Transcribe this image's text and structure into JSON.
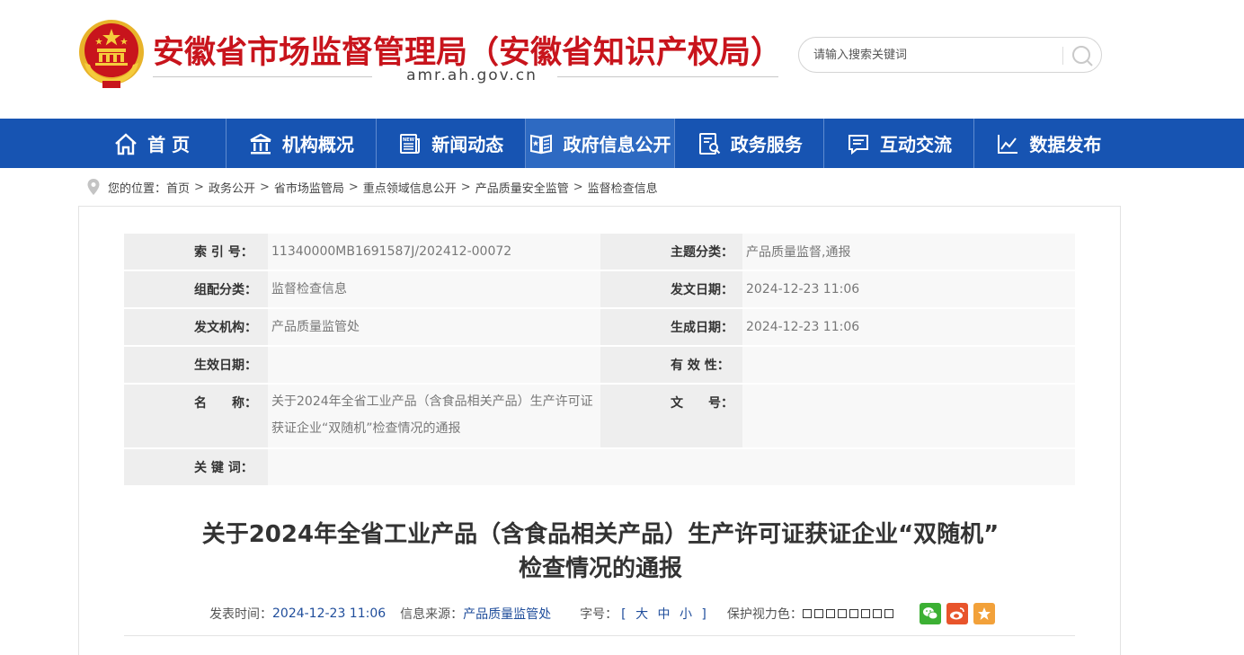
{
  "header": {
    "title": "安徽省市场监督管理局（安徽省知识产权局）",
    "domain": "amr.ah.gov.cn",
    "search_placeholder": "请输入搜索关键词",
    "brand_color": "#c8141c"
  },
  "nav": {
    "items": [
      {
        "label": "首 页",
        "icon": "home-icon"
      },
      {
        "label": "机构概况",
        "icon": "institution-icon"
      },
      {
        "label": "新闻动态",
        "icon": "news-icon"
      },
      {
        "label": "政府信息公开",
        "icon": "gov-info-icon",
        "active": true
      },
      {
        "label": "政务服务",
        "icon": "service-icon"
      },
      {
        "label": "互动交流",
        "icon": "chat-icon"
      },
      {
        "label": "数据发布",
        "icon": "chart-icon"
      }
    ],
    "bg_color": "#1754b2"
  },
  "breadcrumb": {
    "prefix": "您的位置：",
    "items": [
      "首页",
      "政务公开",
      "省市场监管局",
      "重点领域信息公开",
      "产品质量安全监管",
      "监督检查信息"
    ]
  },
  "info": {
    "index_label": "索 引 号：",
    "index_value": "11340000MB1691587J/202412-00072",
    "topic_label": "主题分类：",
    "topic_value": "产品质量监督,通报",
    "org_label": "组配分类：",
    "org_value": "监督检查信息",
    "date_label": "发文日期：",
    "date_value": "2024-12-23 11:06",
    "issuer_label": "发文机构：",
    "issuer_value": "产品质量监管处",
    "gen_label": "生成日期：",
    "gen_value": "2024-12-23 11:06",
    "effective_label": "生效日期：",
    "effective_value": "",
    "validity_label": "有 效 性：",
    "validity_value": "",
    "name_label": "名　　称：",
    "name_value": "关于2024年全省工业产品（含食品相关产品）生产许可证获证企业“双随机”检查情况的通报",
    "docno_label": "文　　号：",
    "docno_value": "",
    "keywords_label": "关 键 词：",
    "keywords_value": ""
  },
  "article": {
    "title_line1": "关于2024年全省工业产品（含食品相关产品）生产许可证获证企业“双随机”",
    "title_line2": "检查情况的通报",
    "pub_time_label": "发表时间：",
    "pub_time": "2024-12-23 11:06",
    "source_label": "信息来源：",
    "source": "产品质量监管处",
    "font_label": "字号：",
    "font_sizes": "[ 大 中 小 ]",
    "color_label": "保护视力色："
  },
  "share": [
    {
      "icon": "wechat-icon",
      "color": "#3cb034"
    },
    {
      "icon": "weibo-icon",
      "color": "#e8542b"
    },
    {
      "icon": "favorite-icon",
      "color": "#f2a13a"
    }
  ]
}
